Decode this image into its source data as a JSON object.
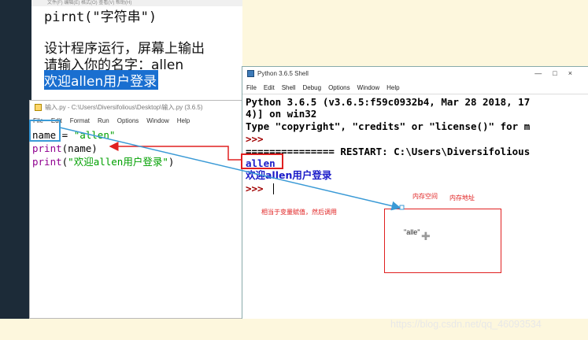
{
  "background_editor": {
    "menu_fragment": "文件(F)  编辑(E)  格式(O)  查看(V)  帮助(H)",
    "line1": "pirnt(\"字符串\")",
    "line2": "设计程序运行，屏幕上输出",
    "line3": "请输入你的名字：allen",
    "line4": "欢迎allen用户登录"
  },
  "idle_editor": {
    "title": "输入.py - C:\\Users\\Diversifolious\\Desktop\\输入.py (3.6.5)",
    "menu": [
      "File",
      "Edit",
      "Format",
      "Run",
      "Options",
      "Window",
      "Help"
    ],
    "code": {
      "l1_var": "name",
      "l1_eq": " = ",
      "l1_str": "\"allen\"",
      "l2_fn": "print",
      "l2_arg": "(name)",
      "l3_fn": "print",
      "l3_open": "(",
      "l3_str": "\"欢迎allen用户登录\"",
      "l3_close": ")"
    }
  },
  "shell": {
    "title": "Python 3.6.5 Shell",
    "window_buttons": "—□×",
    "menu": [
      "File",
      "Edit",
      "Shell",
      "Debug",
      "Options",
      "Window",
      "Help"
    ],
    "lines": [
      "Python 3.6.5 (v3.6.5:f59c0932b4, Mar 28 2018, 17",
      "4)] on win32",
      "Type \"copyright\", \"credits\" or \"license()\" for m",
      ">>>",
      "=============== RESTART: C:\\Users\\Diversifolious",
      "allen",
      "欢迎allen用户登录",
      ">>> "
    ]
  },
  "annotations": {
    "memory_space": "内存空间",
    "memory_address": "内存地址",
    "assign_note": "相当于变量赋值，然后调用",
    "value_label": "\"alle\"",
    "move_icon": "move-cross-icon",
    "watermark": "https://blog.csdn.net/qq_46093534"
  },
  "colors": {
    "arrow_blue": "#3a9ad6",
    "arrow_red": "#e02020",
    "highlight_blue": "#1a6fd0",
    "dark_band": "#1c2b38"
  }
}
